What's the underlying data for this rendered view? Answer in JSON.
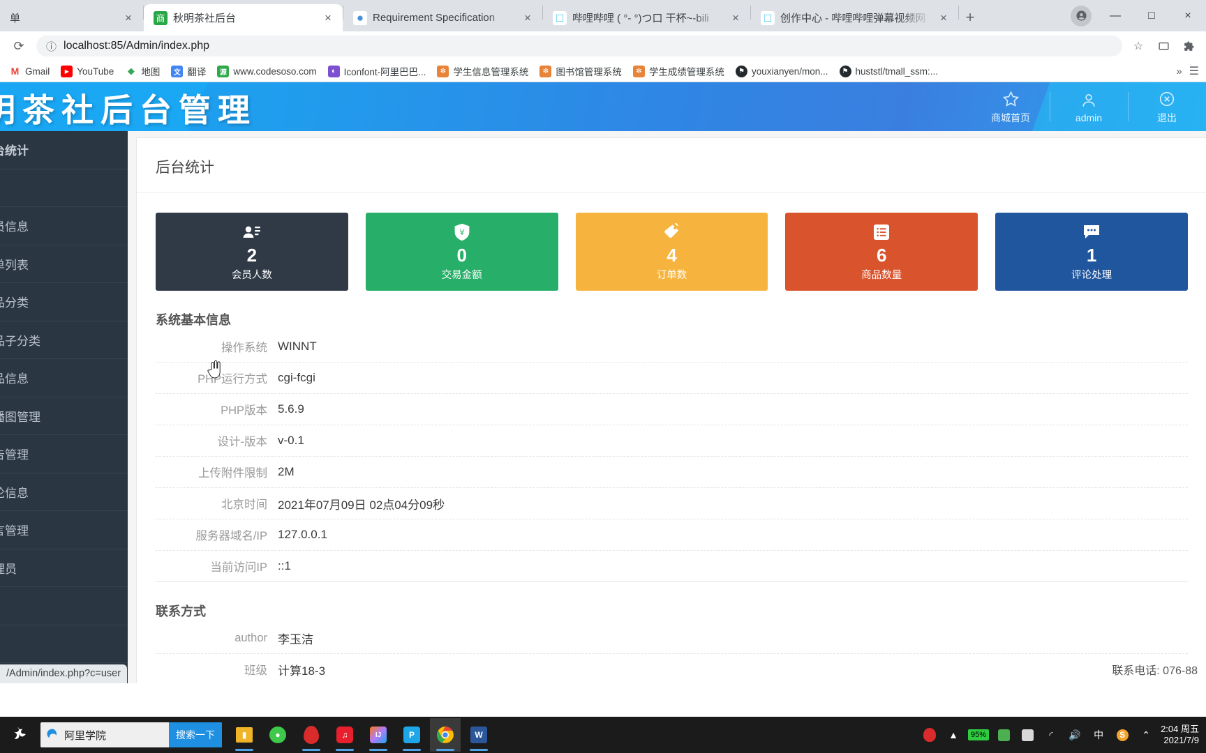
{
  "browser": {
    "tabs": [
      {
        "title": "单",
        "favicon_color": "#cfd3d7",
        "favicon_glyph": "",
        "active": false,
        "partial": true
      },
      {
        "title": "秋明茶社后台",
        "favicon_color": "#27a745",
        "favicon_glyph": "商",
        "active": true
      },
      {
        "title": "Requirement Specification",
        "favicon_color": "#4a90d9",
        "favicon_glyph": "●",
        "active": false
      },
      {
        "title": "哔哩哔哩 ( °- °)つ口 干杯~-bili",
        "favicon_color": "#2ec4e6",
        "favicon_glyph": "□",
        "active": false
      },
      {
        "title": "创作中心 - 哔哩哔哩弹幕视频网",
        "favicon_color": "#2ec4e6",
        "favicon_glyph": "□",
        "active": false
      }
    ],
    "new_tab_label": "+",
    "close_label": "×",
    "window_controls": {
      "minimize": "—",
      "maximize": "□",
      "close": "×"
    },
    "url": "localhost:85/Admin/index.php",
    "reload_label": "⟳",
    "info_icon": "ⓘ",
    "star_icon": "☆",
    "bookmarks": [
      {
        "label": "Gmail",
        "icon_glyph": "M",
        "icon_color": "#ea4335",
        "icon_bg": "transparent"
      },
      {
        "label": "YouTube",
        "icon_glyph": "▶",
        "icon_color": "#ffffff",
        "icon_bg": "#ff0000"
      },
      {
        "label": "地图",
        "icon_glyph": "◆",
        "icon_color": "#34a853",
        "icon_bg": "transparent"
      },
      {
        "label": "翻译",
        "icon_glyph": "文",
        "icon_color": "#ffffff",
        "icon_bg": "#4285f4"
      },
      {
        "label": "www.codesoso.com",
        "icon_glyph": "源",
        "icon_color": "#ffffff",
        "icon_bg": "#2eaa4b"
      },
      {
        "label": "Iconfont-阿里巴巴...",
        "icon_glyph": "◐",
        "icon_color": "#ffffff",
        "icon_bg": "#7d4fd1"
      },
      {
        "label": "学生信息管理系统",
        "icon_glyph": "✻",
        "icon_color": "#ffffff",
        "icon_bg": "#e8833a"
      },
      {
        "label": "图书馆管理系统",
        "icon_glyph": "✻",
        "icon_color": "#ffffff",
        "icon_bg": "#e8833a"
      },
      {
        "label": "学生成绩管理系统",
        "icon_glyph": "✻",
        "icon_color": "#ffffff",
        "icon_bg": "#e8833a"
      },
      {
        "label": "youxianyen/mon...",
        "icon_glyph": "⚑",
        "icon_color": "#ffffff",
        "icon_bg": "#24292e"
      },
      {
        "label": "huststl/tmall_ssm:...",
        "icon_glyph": "⚑",
        "icon_color": "#ffffff",
        "icon_bg": "#24292e"
      }
    ],
    "bookmarks_overflow": "»",
    "status_bubble": "/Admin/index.php?c=user"
  },
  "app_header": {
    "logo_text": "明茶社后台管理",
    "tools": [
      {
        "label": "商城首页",
        "icon": "star-icon"
      },
      {
        "label": "admin",
        "icon": "user-icon"
      },
      {
        "label": "退出",
        "icon": "logout-icon"
      }
    ]
  },
  "sidebar": {
    "items": [
      {
        "label": "后台统计",
        "is_head": true
      },
      {
        "label": " "
      },
      {
        "label": "会员信息"
      },
      {
        "label": "订单列表"
      },
      {
        "label": "商品分类"
      },
      {
        "label": "商品子分类"
      },
      {
        "label": "商品信息"
      },
      {
        "label": "轮播图管理"
      },
      {
        "label": "公告管理"
      },
      {
        "label": "评论信息"
      },
      {
        "label": "留言管理"
      },
      {
        "label": "管理员"
      },
      {
        "label": " "
      },
      {
        "label": " "
      }
    ]
  },
  "main": {
    "panel_title": "后台统计",
    "cards": [
      {
        "value": "2",
        "label": "会员人数",
        "color": "#2f3a46",
        "icon": "user-list-icon"
      },
      {
        "value": "0",
        "label": "交易金额",
        "color": "#27ae68",
        "icon": "yen-shield-icon"
      },
      {
        "value": "4",
        "label": "订单数",
        "color": "#f6b43e",
        "icon": "tag-icon"
      },
      {
        "value": "6",
        "label": "商品数量",
        "color": "#d9532c",
        "icon": "list-box-icon"
      },
      {
        "value": "1",
        "label": "评论处理",
        "color": "#20569e",
        "icon": "comment-icon"
      }
    ],
    "sections": [
      {
        "heading": "系统基本信息",
        "rows": [
          {
            "key": "操作系统",
            "value": "WINNT"
          },
          {
            "key": "PHP运行方式",
            "value": "cgi-fcgi"
          },
          {
            "key": "PHP版本",
            "value": "5.6.9"
          },
          {
            "key": "设计-版本",
            "value": "v-0.1"
          },
          {
            "key": "上传附件限制",
            "value": "2M"
          },
          {
            "key": "北京时间",
            "value": "2021年07月09日 02点04分09秒"
          },
          {
            "key": "服务器域名/IP",
            "value": "127.0.0.1"
          },
          {
            "key": "当前访问IP",
            "value": "::1"
          }
        ]
      },
      {
        "heading": "联系方式",
        "rows": [
          {
            "key": "author",
            "value": "李玉洁"
          },
          {
            "key": "班级",
            "value": "计算18-3"
          }
        ]
      }
    ],
    "footer_note": "联系电话: 076-88"
  },
  "taskbar": {
    "search_text": "阿里学院",
    "search_button": "搜索一下",
    "apps": [
      {
        "name": "file-explorer",
        "glyph": "▤",
        "color": "#f0b429",
        "running": true
      },
      {
        "name": "wechat",
        "glyph": "●",
        "color": "#3ec94a",
        "running": false
      },
      {
        "name": "navicat",
        "glyph": "●",
        "color": "#d92b2b",
        "running": true
      },
      {
        "name": "netease-music",
        "glyph": "♫",
        "color": "#e81f2d",
        "running": true
      },
      {
        "name": "intellij-idea",
        "glyph": "IJ",
        "color": "#7c4dff",
        "running": true
      },
      {
        "name": "pycharm",
        "glyph": "P",
        "color": "#1ea7e8",
        "running": true
      },
      {
        "name": "chrome",
        "glyph": "◉",
        "color": "#4285f4",
        "running": true,
        "active": true
      },
      {
        "name": "word",
        "glyph": "W",
        "color": "#2b579a",
        "running": true
      }
    ],
    "battery_pct": "95%",
    "ime_label": "中",
    "clock_time": "2:04 周五",
    "clock_date": "2021/7/9"
  }
}
